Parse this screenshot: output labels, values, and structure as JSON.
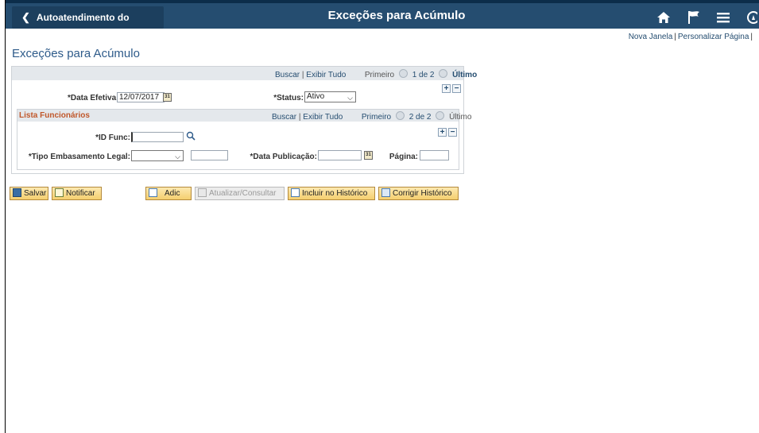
{
  "header": {
    "back_label": "Autoatendimento do Gerente",
    "title": "Exceções para Acúmulo",
    "icons": [
      "home-icon",
      "flag-icon",
      "menu-icon",
      "navbar-icon"
    ]
  },
  "top_links": {
    "new_window": "Nova Janela",
    "separator": "|",
    "personalize": "Personalizar Página"
  },
  "page_title": "Exceções para Acúmulo",
  "main_panel": {
    "find": "Buscar",
    "view_all": "Exibir Tudo",
    "first": "Primeiro",
    "pager": "1 de 2",
    "last": "Último",
    "effective_date_label": "*Data Efetiva:",
    "effective_date_value": "12/07/2017",
    "status_label": "*Status:",
    "status_value": "Ativo"
  },
  "employee_list": {
    "title": "Lista Funcionários",
    "find": "Buscar",
    "view_all": "Exibir Tudo",
    "first": "Primeiro",
    "pager": "2 de 2",
    "last": "Último",
    "emp_id_label": "*ID Func:",
    "emp_id_value": "",
    "legal_basis_label": "*Tipo Embasamento Legal:",
    "legal_basis_value": "",
    "legal_basis_text": "",
    "publication_date_label": "*Data Publicação:",
    "publication_date_value": "",
    "page_label": "Página:",
    "page_value": ""
  },
  "toolbar": {
    "save": "Salvar",
    "notify": "Notificar",
    "add": "Adic",
    "update_display": "Atualizar/Consultar",
    "include_history": "Incluir no Histórico",
    "correct_history": "Corrigir Histórico"
  },
  "colors": {
    "header_bg": "#254d70",
    "link": "#254d70",
    "section_title": "#c0572a",
    "button_bg": "#f5cf6f"
  }
}
